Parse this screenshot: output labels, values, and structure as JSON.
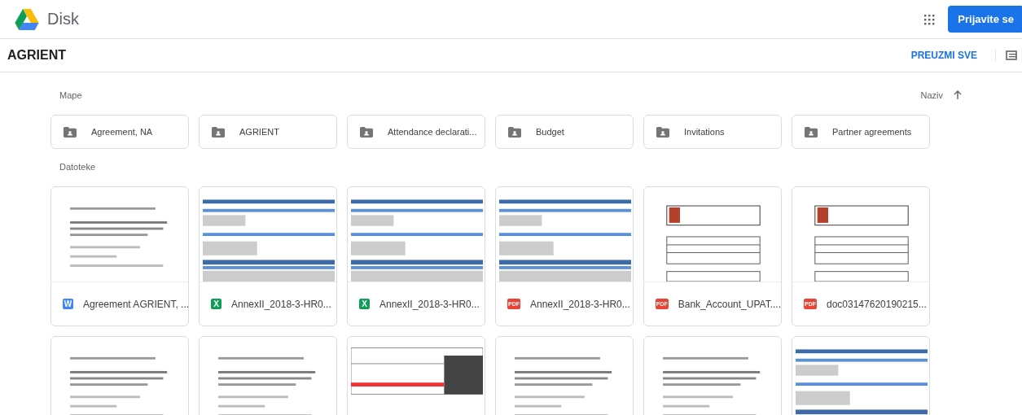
{
  "header": {
    "app_name": "Disk",
    "sign_in": "Prijavite se"
  },
  "toolbar": {
    "title": "AGRIENT",
    "download_all": "PREUZMI SVE"
  },
  "folders_section": {
    "label": "Mape",
    "sort_label": "Naziv"
  },
  "folders": [
    {
      "name": "Agreement, NA"
    },
    {
      "name": "AGRIENT"
    },
    {
      "name": "Attendance declarati..."
    },
    {
      "name": "Budget"
    },
    {
      "name": "Invitations"
    },
    {
      "name": "Partner agreements"
    }
  ],
  "files_section": {
    "label": "Datoteke"
  },
  "files": [
    {
      "name": "Agreement AGRIENT, ...",
      "kind": "doc",
      "badge": "W",
      "preview": {
        "kind": "text"
      }
    },
    {
      "name": "AnnexII_2018-3-HR0...",
      "kind": "sheet",
      "badge": "X",
      "preview": {
        "kind": "form"
      }
    },
    {
      "name": "AnnexII_2018-3-HR0...",
      "kind": "sheet",
      "badge": "X",
      "preview": {
        "kind": "form"
      }
    },
    {
      "name": "AnnexII_2018-3-HR0...",
      "kind": "pdf",
      "badge": "PDF",
      "preview": {
        "kind": "form"
      }
    },
    {
      "name": "Bank_Account_UPAT....",
      "kind": "pdf",
      "badge": "PDF",
      "preview": {
        "kind": "bank"
      }
    },
    {
      "name": "doc03147620190215...",
      "kind": "pdf",
      "badge": "PDF",
      "preview": {
        "kind": "bank"
      }
    }
  ],
  "more_files": [
    {
      "preview": {
        "kind": "text"
      }
    },
    {
      "preview": {
        "kind": "text"
      }
    },
    {
      "preview": {
        "kind": "grid"
      }
    },
    {
      "preview": {
        "kind": "text"
      }
    },
    {
      "preview": {
        "kind": "text"
      }
    },
    {
      "preview": {
        "kind": "form"
      }
    }
  ]
}
